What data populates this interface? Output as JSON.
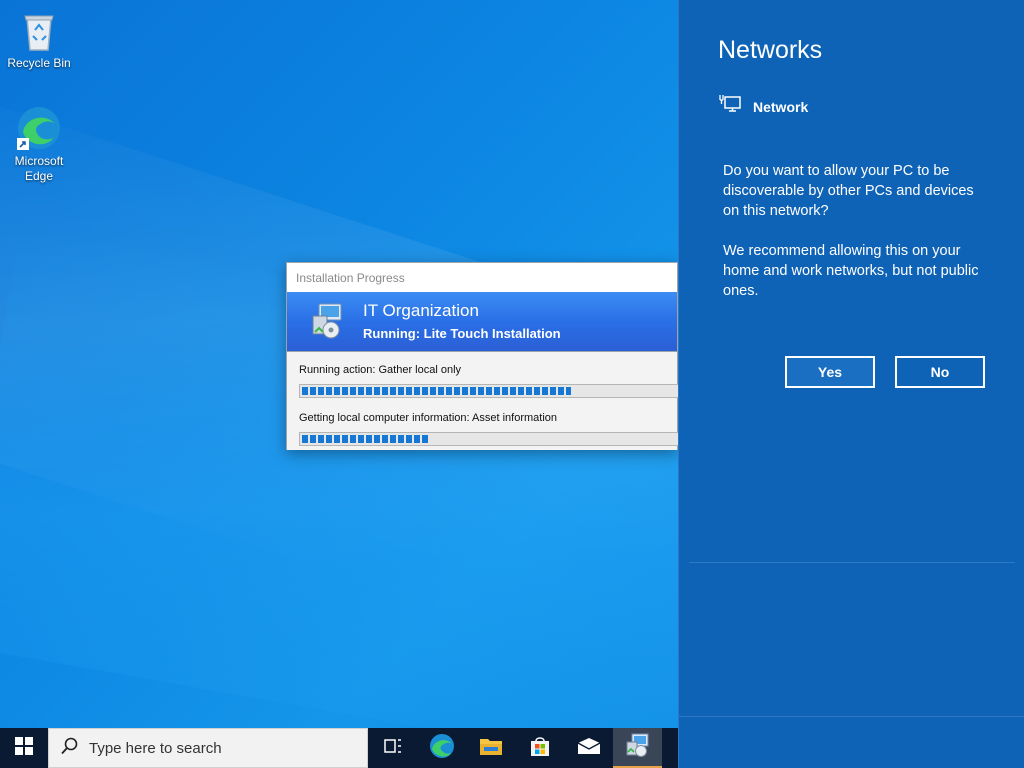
{
  "desktop": {
    "icons": [
      {
        "label": "Recycle Bin"
      },
      {
        "label_line1": "Microsoft",
        "label_line2": "Edge"
      }
    ]
  },
  "install_progress": {
    "window_title": "Installation Progress",
    "organization": "IT Organization",
    "running": "Running: Lite Touch Installation",
    "action_label": "Running action: Gather local only",
    "action_progress_fraction": 0.72,
    "info_label": "Getting local computer information: Asset information",
    "info_progress_fraction": 0.34
  },
  "networks_panel": {
    "title": "Networks",
    "network_name": "Network",
    "question": "Do you want to allow your PC to be discoverable by other PCs and devices on this network?",
    "recommendation": "We recommend allowing this on your home and work networks, but not public ones.",
    "yes_label": "Yes",
    "no_label": "No"
  },
  "taskbar": {
    "search_placeholder": "Type here to search",
    "icons": [
      "start-icon",
      "search-icon",
      "task-view-icon",
      "edge-icon",
      "file-explorer-icon",
      "store-icon",
      "mail-icon",
      "deployment-icon"
    ]
  },
  "colors": {
    "flyout_bg": "#0f63b7",
    "taskbar_bg": "#0a1a33",
    "progress_fill": "#1478d4",
    "banner_blue": "#2a6fe6"
  }
}
